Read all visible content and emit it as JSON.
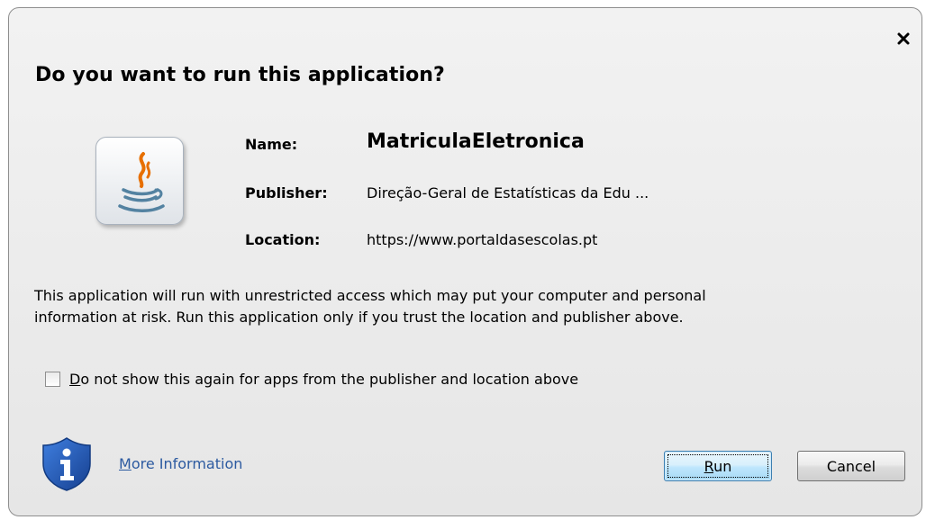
{
  "dialog": {
    "title": "Do you want to run this application?",
    "close_glyph": "×"
  },
  "app": {
    "name_label": "Name:",
    "name_value": "MatriculaEletronica",
    "publisher_label": "Publisher:",
    "publisher_value": "Direção-Geral de Estatísticas da Edu ...",
    "location_label": "Location:",
    "location_value": "https://www.portaldasescolas.pt"
  },
  "warning": {
    "line1": "This application will run with unrestricted access which may put your computer and personal",
    "line2": "information at risk. Run this application only if you trust the location and publisher above."
  },
  "checkbox": {
    "mnemonic": "D",
    "rest": "o not show this again for apps from the publisher and location above",
    "checked": false
  },
  "more_info": {
    "mnemonic": "M",
    "rest": "ore Information"
  },
  "buttons": {
    "run_mnemonic": "R",
    "run_rest": "un",
    "cancel": "Cancel"
  },
  "icons": {
    "java": "java-coffee-cup-icon",
    "shield": "security-info-shield-icon",
    "close": "close-icon"
  },
  "colors": {
    "link": "#2c5aa0",
    "shield_blue": "#1f4fa8",
    "java_orange": "#e76f00",
    "java_blue": "#5382a1"
  }
}
